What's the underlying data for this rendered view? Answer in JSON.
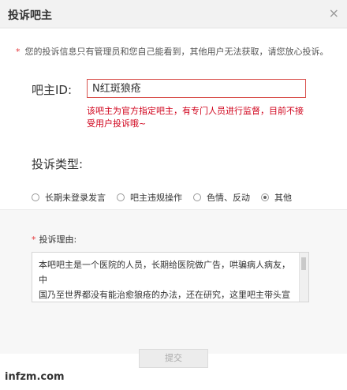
{
  "dialog": {
    "title": "投诉吧主",
    "close_glyph": "×"
  },
  "notice": {
    "star": "*",
    "text": "您的投诉信息只有管理员和您自己能看到，其他用户无法获取，请您放心投诉。"
  },
  "bar_owner": {
    "label": "吧主ID:",
    "value": "N红斑狼疮",
    "error": "该吧主为官方指定吧主，有专门人员进行监督，目前不接受用户投诉哦~"
  },
  "complaint_type": {
    "label": "投诉类型:",
    "options": [
      {
        "label": "长期未登录发言",
        "selected": false
      },
      {
        "label": "吧主违规操作",
        "selected": false
      },
      {
        "label": "色情、反动",
        "selected": false
      },
      {
        "label": "其他",
        "selected": true
      }
    ]
  },
  "reason": {
    "star": "*",
    "label": "投诉理由:",
    "text": "本吧吧主是一个医院的人员，长期给医院做广告，哄骗病人病友，中\n国乃至世界都没有能治愈狼疮的办法，还在研究，这里吧主带头宣传\n医院，骗病友的良心钱，希望百度监督人员彻查到底，还我们公道，"
  },
  "submit": {
    "label": "提交"
  },
  "watermark": {
    "text": "infzm.com"
  }
}
